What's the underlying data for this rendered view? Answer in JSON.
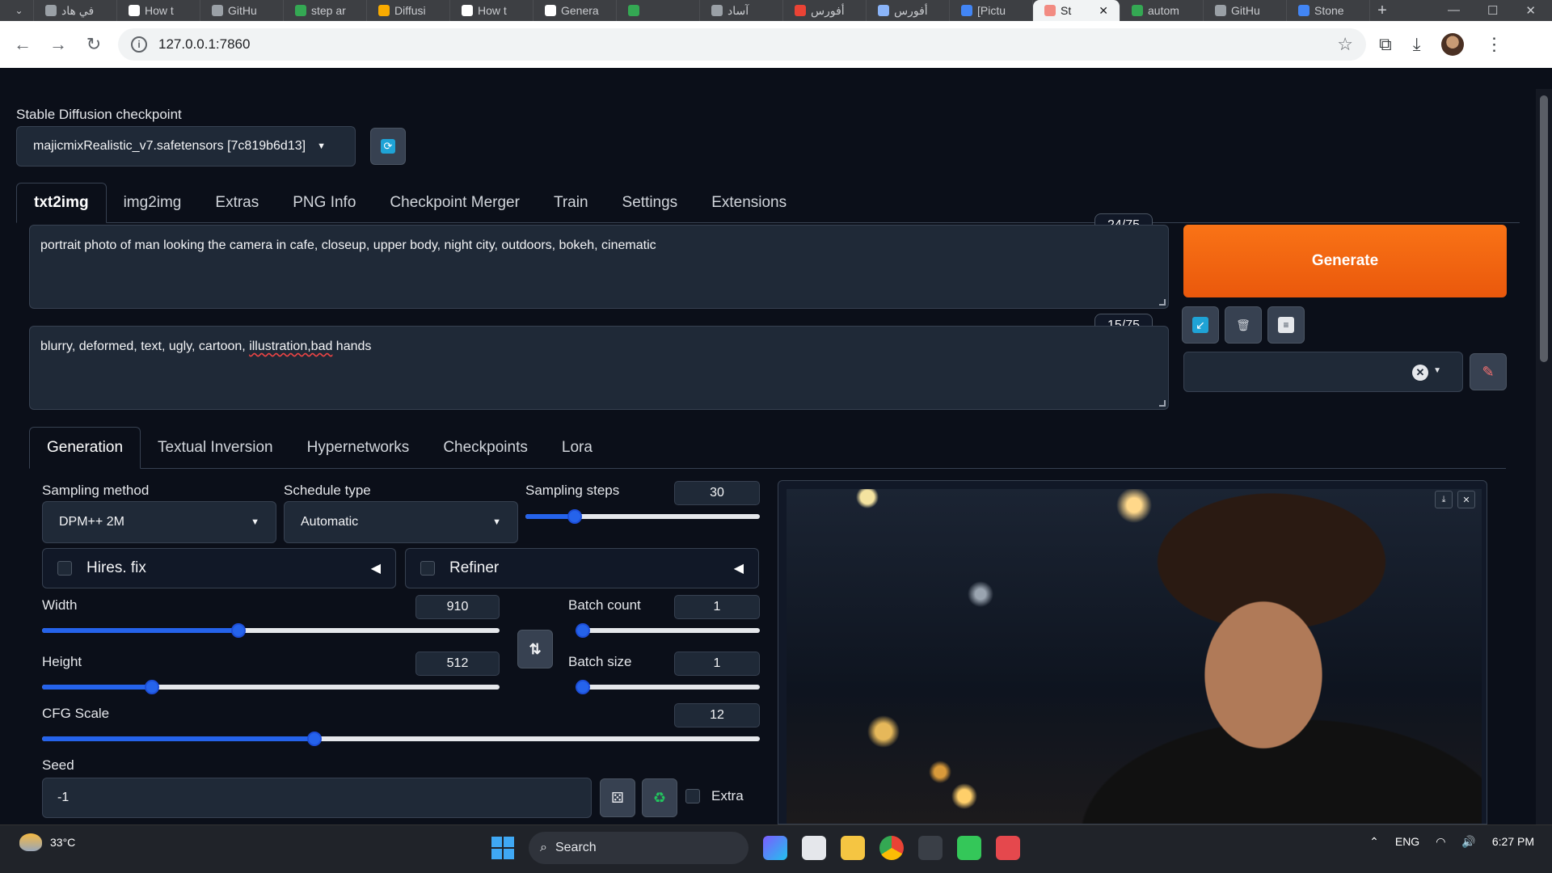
{
  "browser": {
    "tabs": [
      {
        "label": "في هاد",
        "color": "#9aa0a6"
      },
      {
        "label": "How t",
        "color": "#ffffff"
      },
      {
        "label": "GitHu",
        "color": "#9aa0a6"
      },
      {
        "label": "step ar",
        "color": "#34a853"
      },
      {
        "label": "Diffusi",
        "color": "#f9ab00"
      },
      {
        "label": "How t",
        "color": "#ffffff"
      },
      {
        "label": "Genera",
        "color": "#ffffff"
      },
      {
        "label": "",
        "color": "#34a853"
      },
      {
        "label": "آساد",
        "color": "#9aa0a6"
      },
      {
        "label": "أفورس",
        "color": "#ea4335"
      },
      {
        "label": "أفورس",
        "color": "#8ab4f8"
      },
      {
        "label": "[Pictu",
        "color": "#4285f4"
      }
    ],
    "active_tab": {
      "label": "St",
      "color": "#f28b82"
    },
    "right_tabs": [
      {
        "label": "autom",
        "color": "#34a853"
      },
      {
        "label": "GitHu",
        "color": "#9aa0a6"
      },
      {
        "label": "Stone",
        "color": "#4285f4"
      }
    ],
    "url": "127.0.0.1:7860"
  },
  "checkpoint": {
    "label": "Stable Diffusion checkpoint",
    "value": "majicmixRealistic_v7.safetensors [7c819b6d13]"
  },
  "main_tabs": [
    "txt2img",
    "img2img",
    "Extras",
    "PNG Info",
    "Checkpoint Merger",
    "Train",
    "Settings",
    "Extensions"
  ],
  "prompt": {
    "text": "portrait photo of man looking the camera in cafe, closeup, upper body, night city, outdoors, bokeh, cinematic",
    "token_count": "24/75"
  },
  "negative_prompt": {
    "text_before": "blurry, deformed, text, ugly, cartoon, ",
    "text_misspelled": "illustration,bad",
    "text_after": " hands",
    "token_count": "15/75"
  },
  "generate_label": "Generate",
  "sub_tabs": [
    "Generation",
    "Textual Inversion",
    "Hypernetworks",
    "Checkpoints",
    "Lora"
  ],
  "generation": {
    "sampling_method": {
      "label": "Sampling method",
      "value": "DPM++ 2M"
    },
    "schedule_type": {
      "label": "Schedule type",
      "value": "Automatic"
    },
    "sampling_steps": {
      "label": "Sampling steps",
      "value": "30",
      "fraction": 0.21
    },
    "hires_fix": "Hires. fix",
    "refiner": "Refiner",
    "width": {
      "label": "Width",
      "value": "910",
      "fraction": 0.43
    },
    "height": {
      "label": "Height",
      "value": "512",
      "fraction": 0.24
    },
    "batch_count": {
      "label": "Batch count",
      "value": "1",
      "fraction": 0.0
    },
    "batch_size": {
      "label": "Batch size",
      "value": "1",
      "fraction": 0.0
    },
    "cfg_scale": {
      "label": "CFG Scale",
      "value": "12",
      "fraction": 0.38
    },
    "seed": {
      "label": "Seed",
      "value": "-1"
    },
    "extra": "Extra"
  },
  "taskbar": {
    "temperature": "33°C",
    "search": "Search",
    "language": "ENG",
    "time": "6:27 PM"
  }
}
